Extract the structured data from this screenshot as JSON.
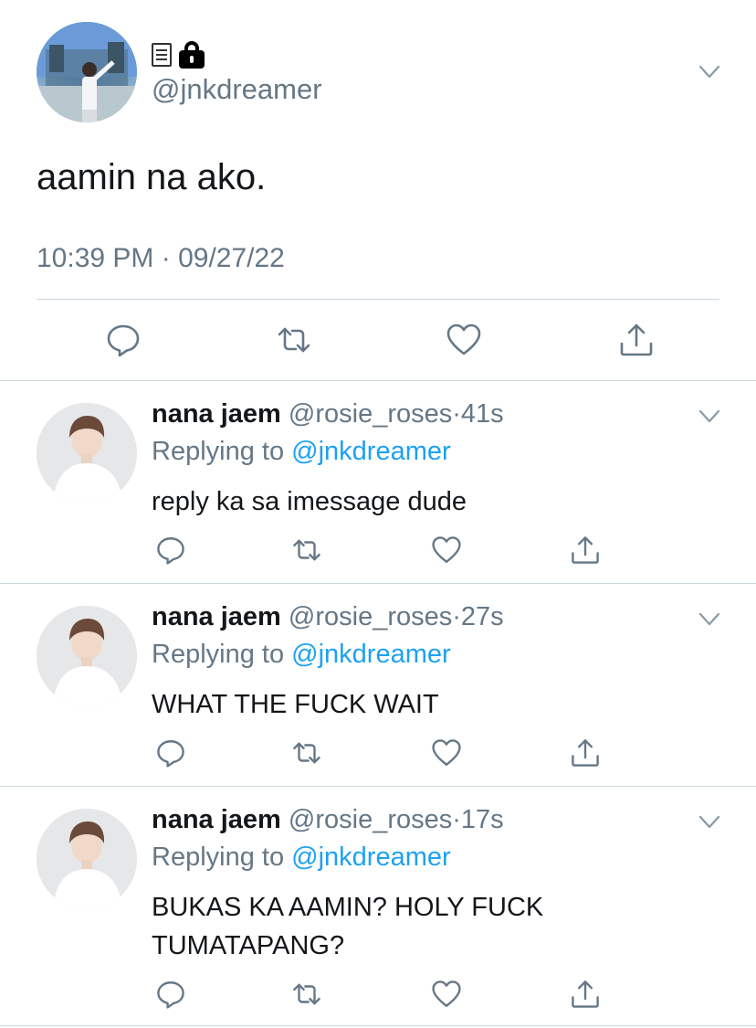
{
  "main_tweet": {
    "handle": "@jnkdreamer",
    "text": "aamin na ako.",
    "timestamp": "10:39 PM · 09/27/22",
    "name_icons": [
      "scroll-icon",
      "lock-icon"
    ]
  },
  "replies": [
    {
      "name": "nana jaem",
      "handle": "@rosie_roses",
      "separator": "·",
      "time": "41s",
      "replying_label": "Replying to",
      "replying_to": "@jnkdreamer",
      "text": "reply ka sa imessage dude"
    },
    {
      "name": "nana jaem",
      "handle": "@rosie_roses",
      "separator": "·",
      "time": "27s",
      "replying_label": "Replying to",
      "replying_to": "@jnkdreamer",
      "text": "WHAT THE FUCK WAIT"
    },
    {
      "name": "nana jaem",
      "handle": "@rosie_roses",
      "separator": "·",
      "time": "17s",
      "replying_label": "Replying to",
      "replying_to": "@jnkdreamer",
      "text": "BUKAS KA AAMIN? HOLY FUCK TUMATAPANG?"
    }
  ],
  "icons": {
    "reply": "reply-icon",
    "retweet": "retweet-icon",
    "like": "heart-icon",
    "share": "share-icon",
    "menu": "chevron-down-icon"
  },
  "colors": {
    "text_primary": "#14171a",
    "text_secondary": "#657786",
    "link": "#1da1f2",
    "divider": "#ccd6dd"
  }
}
